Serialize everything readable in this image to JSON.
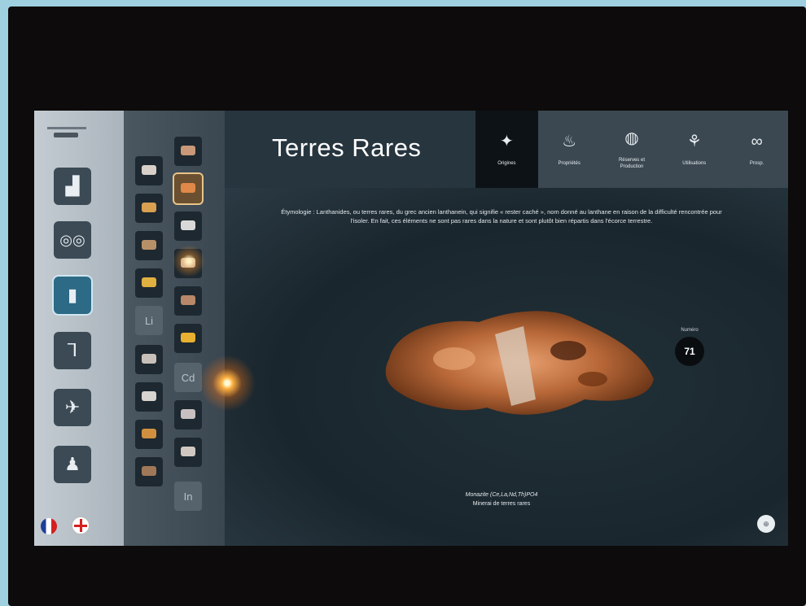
{
  "app": {
    "title": "Terres Rares"
  },
  "left_sidebar": {
    "categories": [
      {
        "icon": "building-icon"
      },
      {
        "icon": "bicycle-icon"
      },
      {
        "icon": "smartphone-icon"
      },
      {
        "icon": "hip-implant-icon"
      },
      {
        "icon": "airplane-icon"
      },
      {
        "icon": "person-icon"
      }
    ],
    "active_index": 2,
    "languages": [
      {
        "icon": "french-flag-icon"
      },
      {
        "icon": "english-flag-icon"
      }
    ]
  },
  "element_grid": {
    "column1": [
      {
        "type": "image",
        "icon": "mineral-icon"
      },
      {
        "type": "image",
        "icon": "mineral-icon"
      },
      {
        "type": "image",
        "icon": "mineral-icon"
      },
      {
        "type": "image",
        "icon": "mineral-icon"
      },
      {
        "type": "symbol",
        "symbol": "Li"
      },
      {
        "type": "image",
        "icon": "mineral-icon"
      },
      {
        "type": "image",
        "icon": "mineral-icon"
      },
      {
        "type": "image",
        "icon": "mineral-icon"
      },
      {
        "type": "image",
        "icon": "mineral-icon"
      }
    ],
    "column2": [
      {
        "type": "image",
        "icon": "mineral-icon"
      },
      {
        "type": "image",
        "icon": "mineral-icon",
        "selected": true
      },
      {
        "type": "image",
        "icon": "mineral-icon"
      },
      {
        "type": "image",
        "icon": "mineral-icon"
      },
      {
        "type": "image",
        "icon": "mineral-icon"
      },
      {
        "type": "image",
        "icon": "mineral-icon"
      },
      {
        "type": "symbol",
        "symbol": "Cd"
      },
      {
        "type": "image",
        "icon": "mineral-icon"
      },
      {
        "type": "image",
        "icon": "mineral-icon"
      },
      {
        "type": "symbol",
        "symbol": "In"
      }
    ]
  },
  "tabs": [
    {
      "label": "Origines",
      "icon": "compass-icon",
      "active": true
    },
    {
      "label": "Propriétés",
      "icon": "flame-icon"
    },
    {
      "label": "Réserves et Production",
      "icon": "globe-icon"
    },
    {
      "label": "Utilisations",
      "icon": "plant-icon"
    },
    {
      "label": "Prosp.",
      "icon": "binoculars-icon"
    }
  ],
  "main": {
    "etymology": "Étymologie : Lanthanides, ou terres rares, du grec ancien lanthanein, qui signifie « rester caché », nom donné au lanthane en raison de la difficulté rencontrée pour l'isoler. En fait, ces éléments ne sont pas rares dans la nature et sont plutôt bien répartis dans l'écorce terrestre.",
    "atomic_label": "Numéro",
    "atomic_number": "71",
    "caption_line1": "Monazite (Ce,La,Nd,Th)PO4",
    "caption_line2": "Minerai de terres rares"
  },
  "colors": {
    "screen_bg": "#2b3a45",
    "header_bg": "#27353f",
    "active_tab_bg": "#0d1216",
    "accent_glow": "#ffb040"
  }
}
